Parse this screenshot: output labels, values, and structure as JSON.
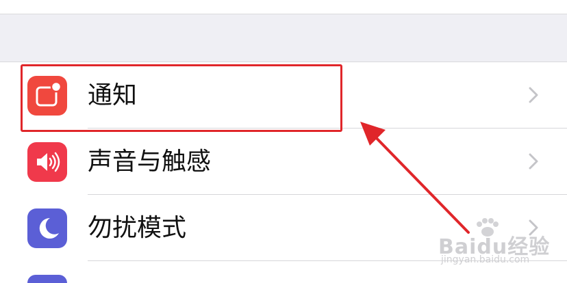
{
  "settings": {
    "items": [
      {
        "label": "通知",
        "icon": "notifications-icon",
        "color": "#f0483e"
      },
      {
        "label": "声音与触感",
        "icon": "speaker-icon",
        "color": "#f0394b"
      },
      {
        "label": "勿扰模式",
        "icon": "moon-icon",
        "color": "#5b5fd6"
      }
    ]
  },
  "annotation": {
    "color": "#e0262a"
  },
  "watermark": {
    "brand": "Baidu经验",
    "url": "jingyan.baidu.com"
  }
}
